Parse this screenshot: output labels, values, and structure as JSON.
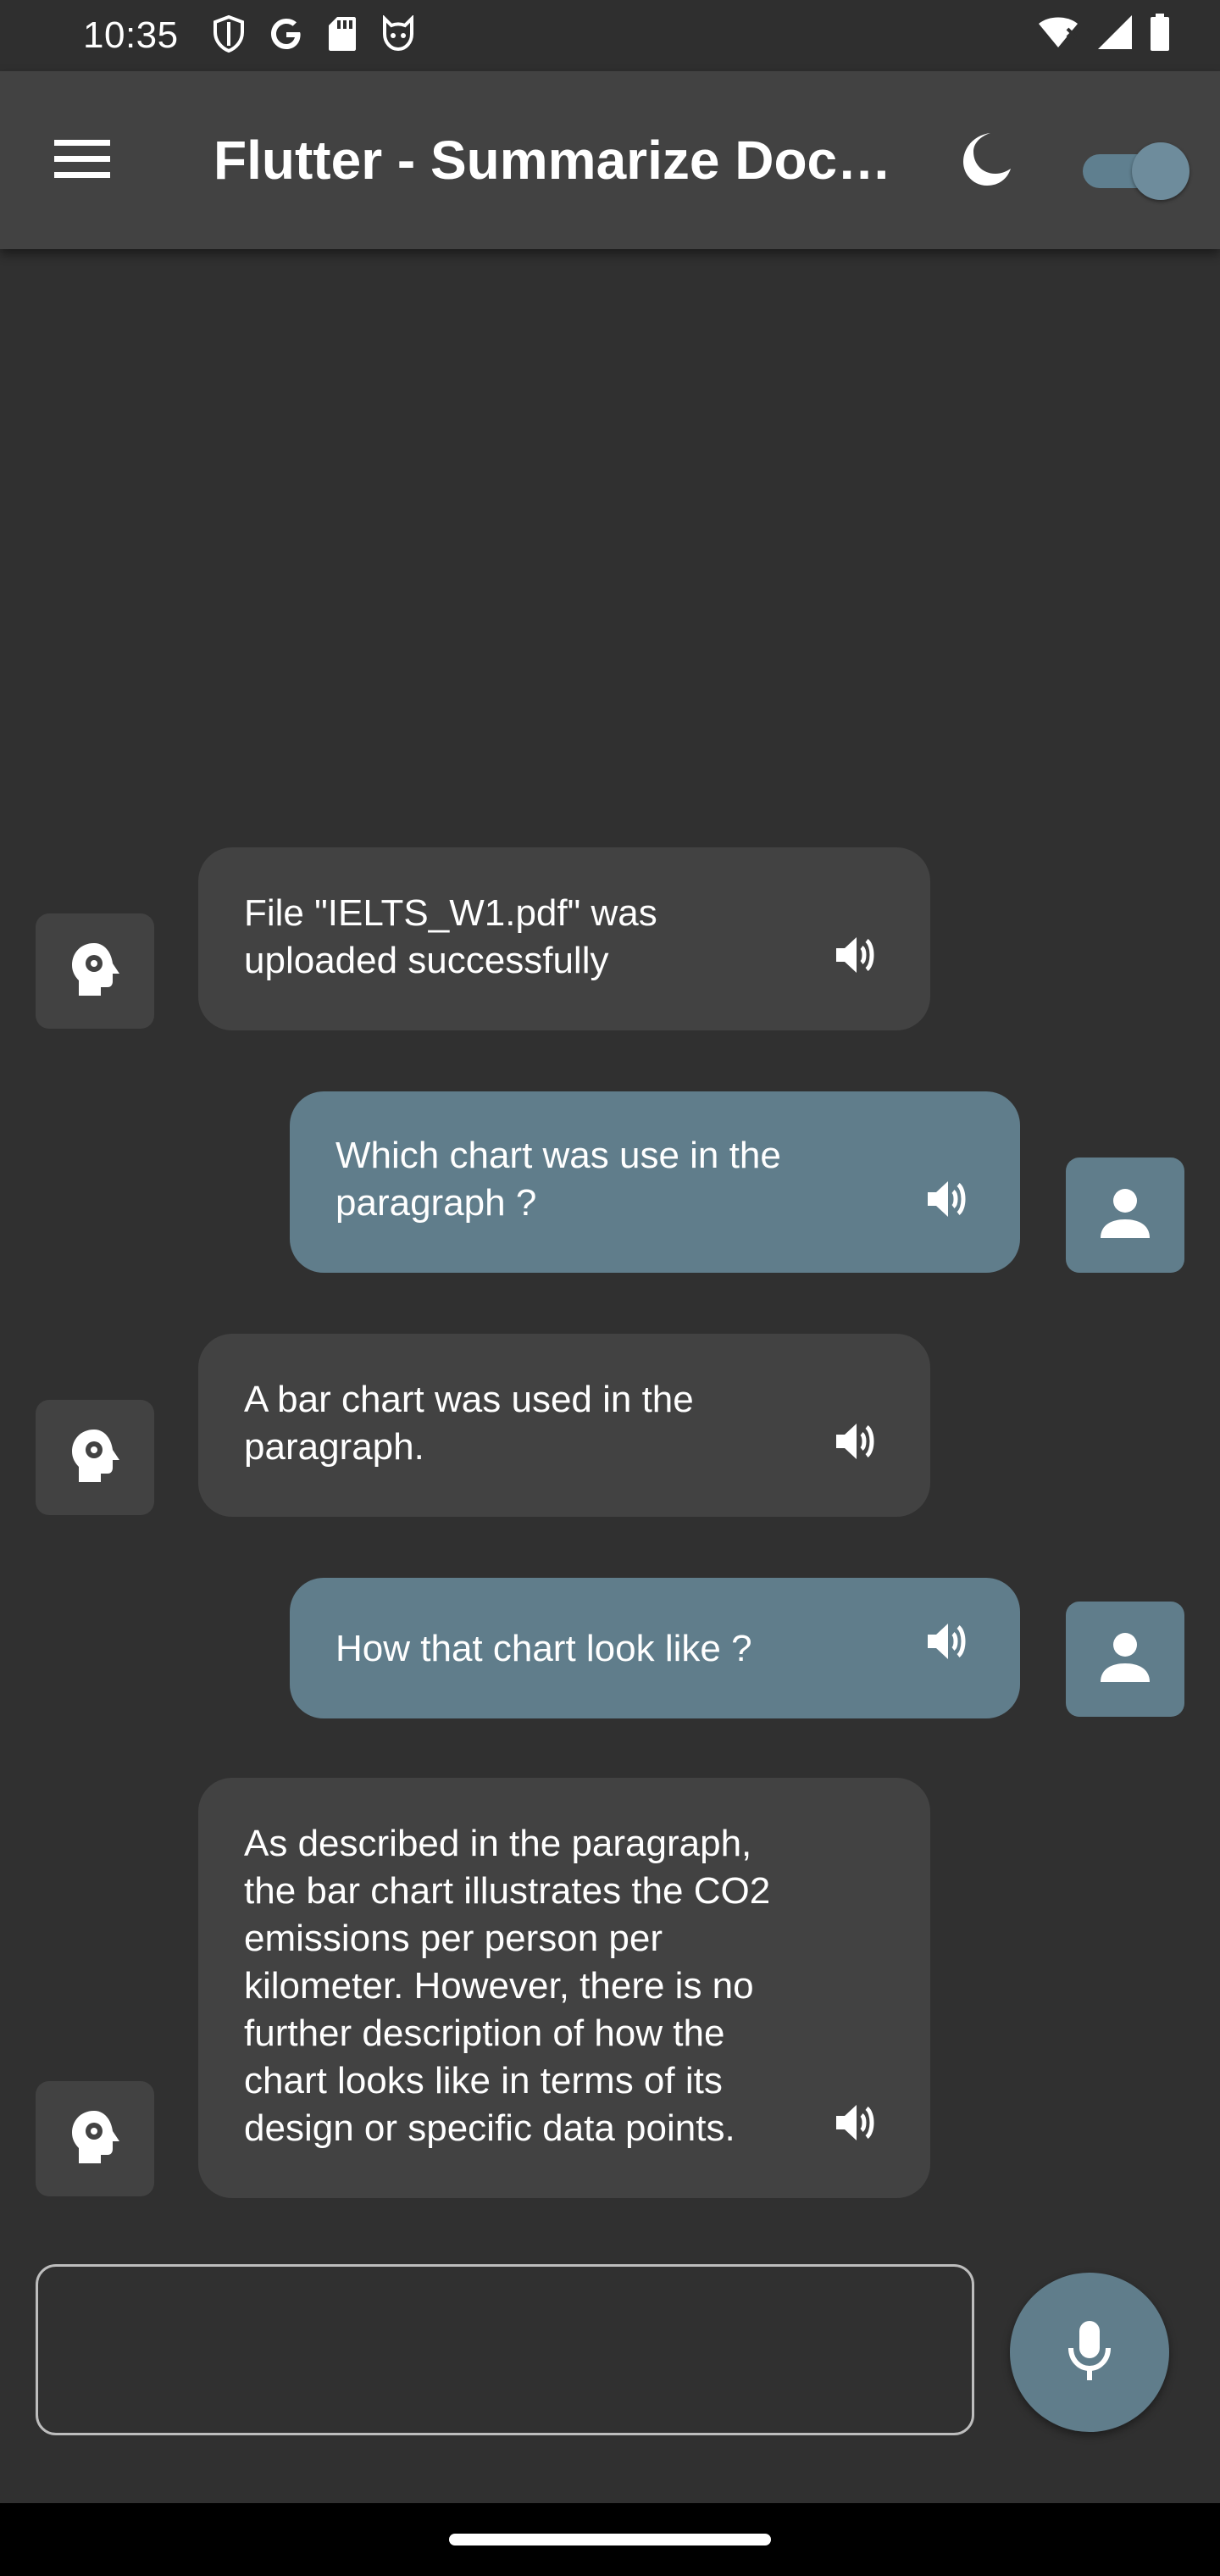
{
  "status_bar": {
    "time": "10:35",
    "left_icons": [
      "shield-icon",
      "google-icon",
      "sd-card-icon",
      "cat-face-icon"
    ],
    "right_icons": [
      "wifi-icon",
      "signal-icon",
      "battery-icon"
    ]
  },
  "app_bar": {
    "title": "Flutter - Summarize Document",
    "menu_icon": "menu-icon",
    "theme_icon": "moon-icon",
    "dark_mode_toggle": true
  },
  "messages": [
    {
      "sender": "bot",
      "lines": [
        "File \"IELTS_W1.pdf\" was",
        "uploaded successfully"
      ]
    },
    {
      "sender": "user",
      "lines": [
        "Which chart was use in the",
        "paragraph ?"
      ]
    },
    {
      "sender": "bot",
      "lines": [
        "A bar chart was used in the",
        "paragraph."
      ]
    },
    {
      "sender": "user",
      "lines": [
        "How that chart look like ?"
      ]
    },
    {
      "sender": "bot",
      "lines": [
        "As described in the paragraph,",
        "the bar chart illustrates the CO2",
        "emissions per person per",
        "kilometer. However, there is no",
        "further description of how the",
        "chart looks like in terms of its",
        "design or specific data points."
      ]
    }
  ],
  "input": {
    "value": "",
    "placeholder": ""
  },
  "colors": {
    "background": "#303030",
    "app_bar": "#424242",
    "bot_bubble": "#424242",
    "user_bubble": "#607d8b",
    "accent": "#607d8b"
  }
}
